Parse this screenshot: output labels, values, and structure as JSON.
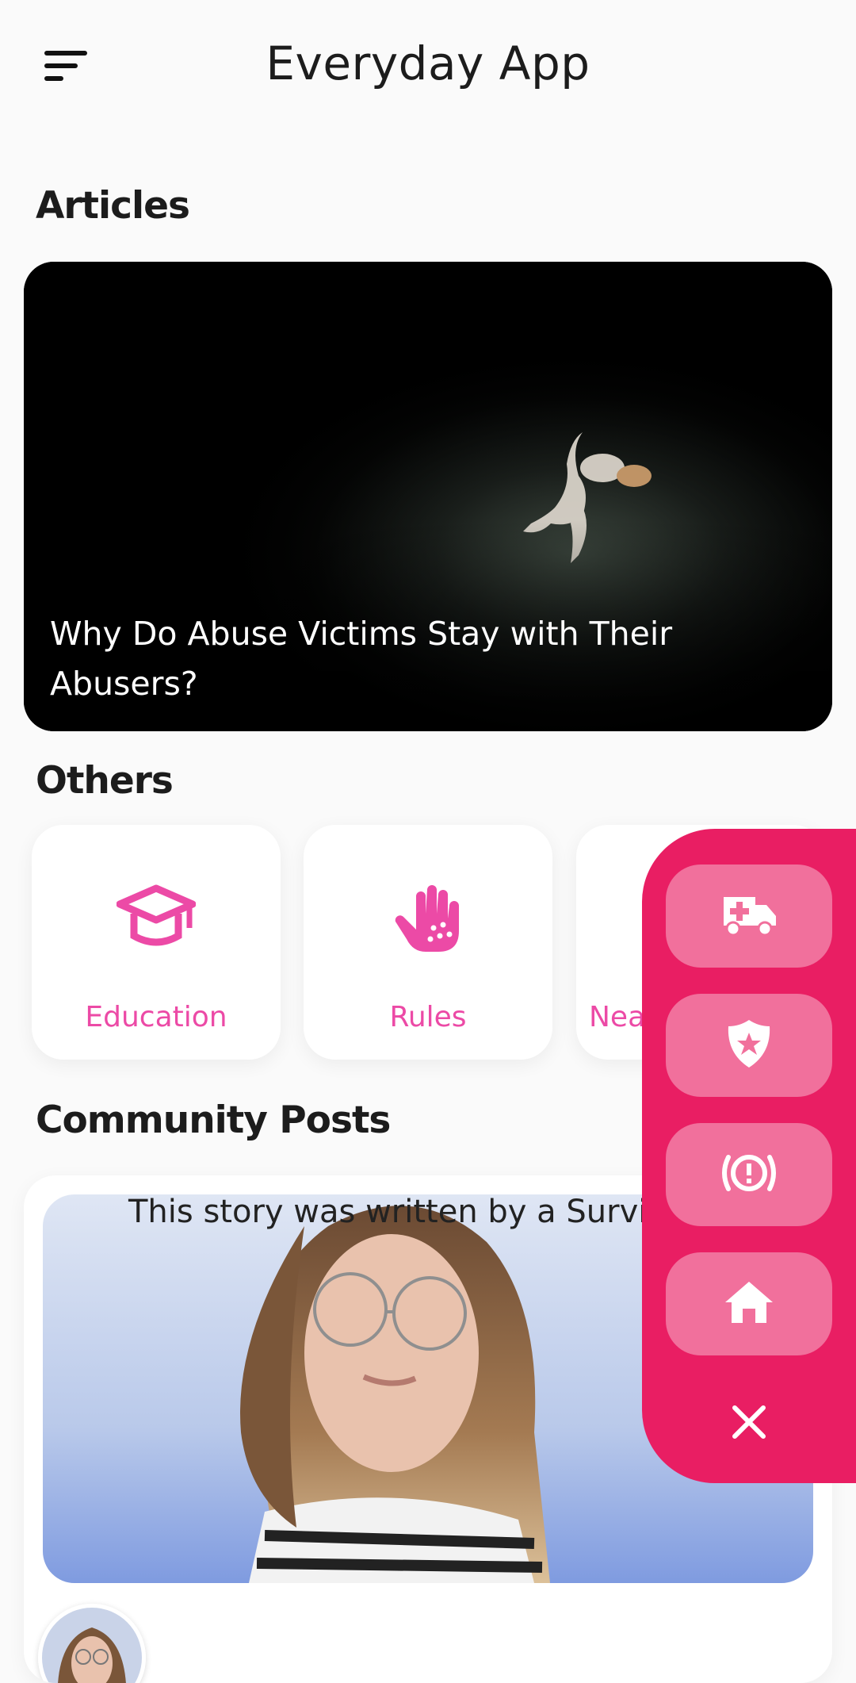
{
  "header": {
    "title": "Everyday App"
  },
  "sections": {
    "articles_title": "Articles",
    "others_title": "Others",
    "community_title": "Community Posts"
  },
  "article": {
    "caption": "Why Do Abuse Victims Stay with Their Abusers?"
  },
  "others": [
    {
      "label": "Education",
      "icon": "graduation-cap-icon"
    },
    {
      "label": "Rules",
      "icon": "hand-icon"
    },
    {
      "label": "Nea",
      "icon": "unknown-icon"
    }
  ],
  "post": {
    "text": "This story was written by a Survivor of"
  },
  "fab": {
    "actions": [
      {
        "icon": "ambulance-icon"
      },
      {
        "icon": "police-badge-icon"
      },
      {
        "icon": "alert-circle-icon"
      },
      {
        "icon": "home-icon"
      }
    ],
    "close_icon": "close-icon"
  },
  "colors": {
    "accent": "#e91e63",
    "accent_light": "#f1709c",
    "tile_label": "#ec4aa6"
  }
}
